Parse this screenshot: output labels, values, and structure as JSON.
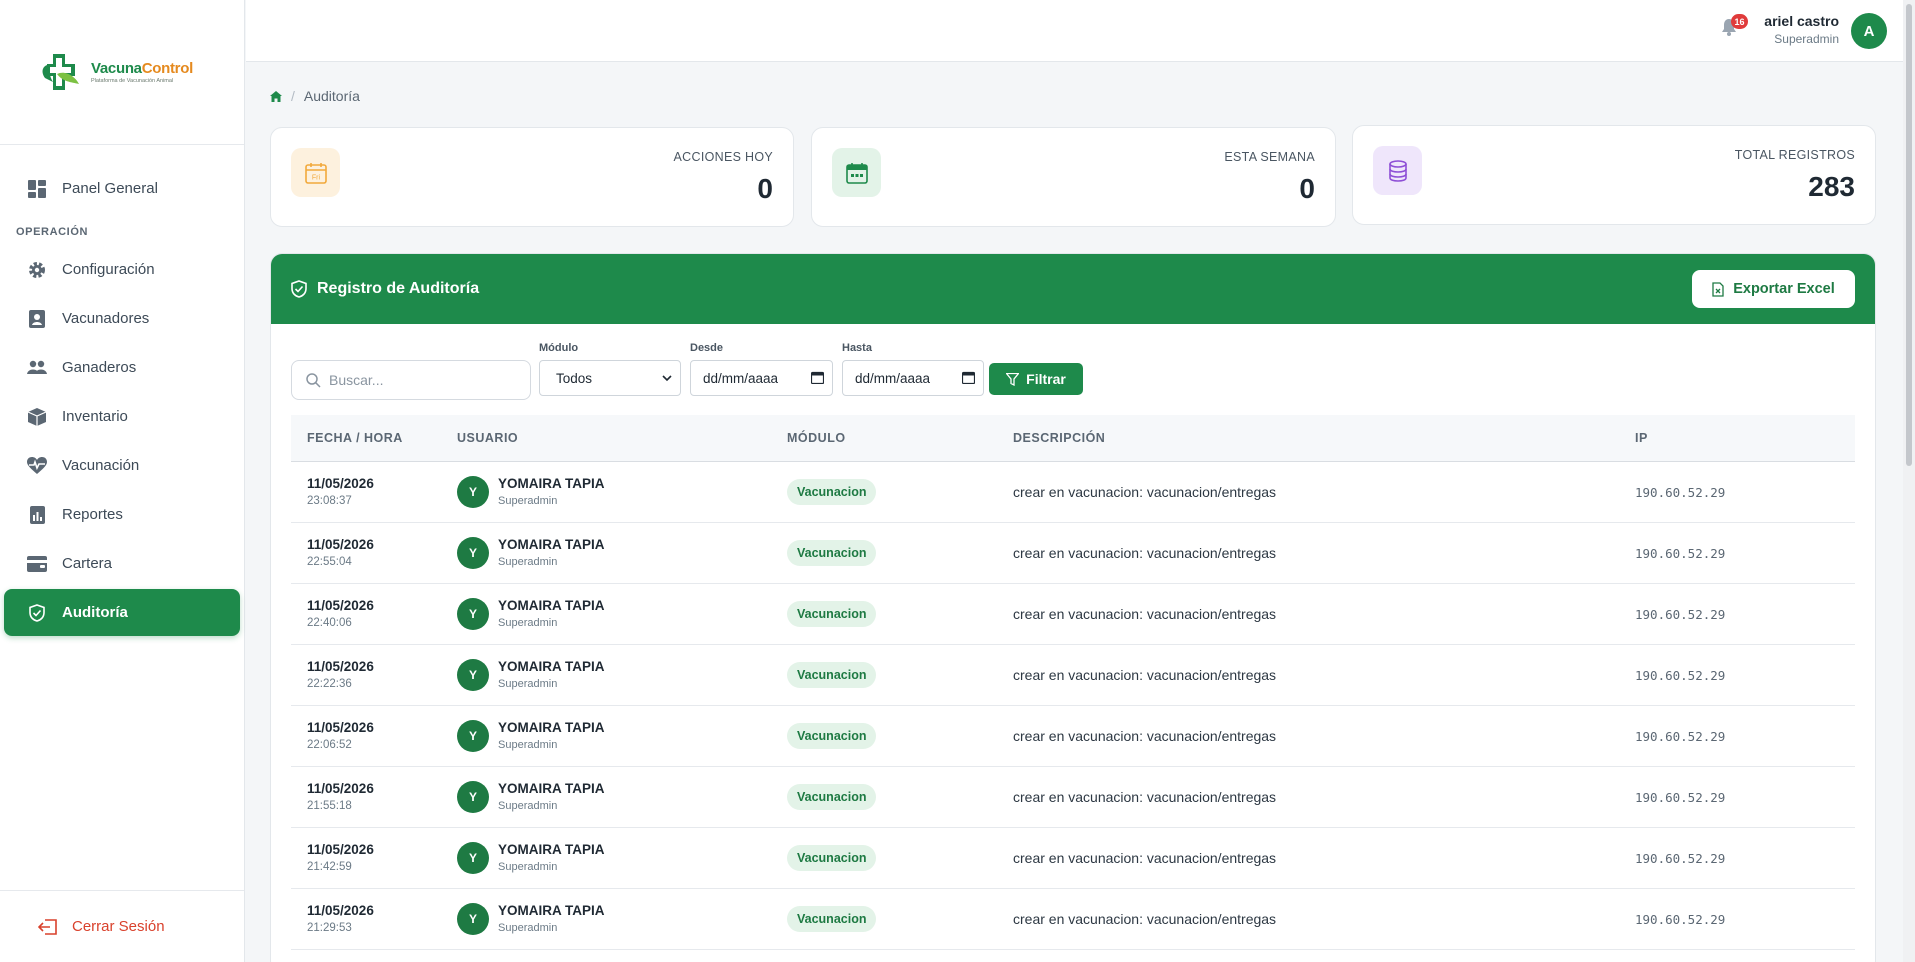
{
  "brand": {
    "name_part1": "Vacuna",
    "name_part2": "Control",
    "tagline": "Plataforma de Vacunación Animal",
    "color": "#1e8a4b",
    "accent": "#e58a1f"
  },
  "sidebar": {
    "items": [
      {
        "label": "Panel General",
        "icon": "dashboard-icon"
      },
      {
        "label": "Configuración",
        "icon": "gear-icon"
      },
      {
        "label": "Vacunadores",
        "icon": "id-badge-icon"
      },
      {
        "label": "Ganaderos",
        "icon": "users-icon"
      },
      {
        "label": "Inventario",
        "icon": "box-icon"
      },
      {
        "label": "Vacunación",
        "icon": "heartbeat-icon"
      },
      {
        "label": "Reportes",
        "icon": "report-icon"
      },
      {
        "label": "Cartera",
        "icon": "wallet-icon"
      },
      {
        "label": "Auditoría",
        "icon": "shield-check-icon",
        "active": true
      }
    ],
    "section_operacion": "OPERACIÓN",
    "logout_label": "Cerrar Sesión"
  },
  "header": {
    "notifications_count": "16",
    "user_name": "ariel castro",
    "user_role": "Superadmin",
    "avatar_initial": "A"
  },
  "breadcrumb": {
    "current": "Auditoría"
  },
  "stats": [
    {
      "label": "ACCIONES HOY",
      "value": "0",
      "icon": "calendar-day-icon",
      "icon_text": "Fri"
    },
    {
      "label": "ESTA SEMANA",
      "value": "0",
      "icon": "calendar-week-icon"
    },
    {
      "label": "TOTAL REGISTROS",
      "value": "283",
      "icon": "database-icon"
    }
  ],
  "audit": {
    "title": "Registro de Auditoría",
    "export_label": "Exportar Excel",
    "search_placeholder": "Buscar...",
    "modulo_label": "Módulo",
    "modulo_value": "Todos",
    "desde_label": "Desde",
    "desde_value": "dd/mm/aaaa",
    "hasta_label": "Hasta",
    "hasta_value": "dd/mm/aaaa",
    "filter_label": "Filtrar",
    "columns": [
      "FECHA / HORA",
      "USUARIO",
      "MÓDULO",
      "DESCRIPCIÓN",
      "IP"
    ],
    "rows": [
      {
        "date": "11/05/2026",
        "time": "23:08:37",
        "initial": "Y",
        "user": "YOMAIRA TAPIA",
        "role": "Superadmin",
        "module": "Vacunacion",
        "desc": "crear en vacunacion: vacunacion/entregas",
        "ip": "190.60.52.29"
      },
      {
        "date": "11/05/2026",
        "time": "22:55:04",
        "initial": "Y",
        "user": "YOMAIRA TAPIA",
        "role": "Superadmin",
        "module": "Vacunacion",
        "desc": "crear en vacunacion: vacunacion/entregas",
        "ip": "190.60.52.29"
      },
      {
        "date": "11/05/2026",
        "time": "22:40:06",
        "initial": "Y",
        "user": "YOMAIRA TAPIA",
        "role": "Superadmin",
        "module": "Vacunacion",
        "desc": "crear en vacunacion: vacunacion/entregas",
        "ip": "190.60.52.29"
      },
      {
        "date": "11/05/2026",
        "time": "22:22:36",
        "initial": "Y",
        "user": "YOMAIRA TAPIA",
        "role": "Superadmin",
        "module": "Vacunacion",
        "desc": "crear en vacunacion: vacunacion/entregas",
        "ip": "190.60.52.29"
      },
      {
        "date": "11/05/2026",
        "time": "22:06:52",
        "initial": "Y",
        "user": "YOMAIRA TAPIA",
        "role": "Superadmin",
        "module": "Vacunacion",
        "desc": "crear en vacunacion: vacunacion/entregas",
        "ip": "190.60.52.29"
      },
      {
        "date": "11/05/2026",
        "time": "21:55:18",
        "initial": "Y",
        "user": "YOMAIRA TAPIA",
        "role": "Superadmin",
        "module": "Vacunacion",
        "desc": "crear en vacunacion: vacunacion/entregas",
        "ip": "190.60.52.29"
      },
      {
        "date": "11/05/2026",
        "time": "21:42:59",
        "initial": "Y",
        "user": "YOMAIRA TAPIA",
        "role": "Superadmin",
        "module": "Vacunacion",
        "desc": "crear en vacunacion: vacunacion/entregas",
        "ip": "190.60.52.29"
      },
      {
        "date": "11/05/2026",
        "time": "21:29:53",
        "initial": "Y",
        "user": "YOMAIRA TAPIA",
        "role": "Superadmin",
        "module": "Vacunacion",
        "desc": "crear en vacunacion: vacunacion/entregas",
        "ip": "190.60.52.29"
      }
    ]
  }
}
